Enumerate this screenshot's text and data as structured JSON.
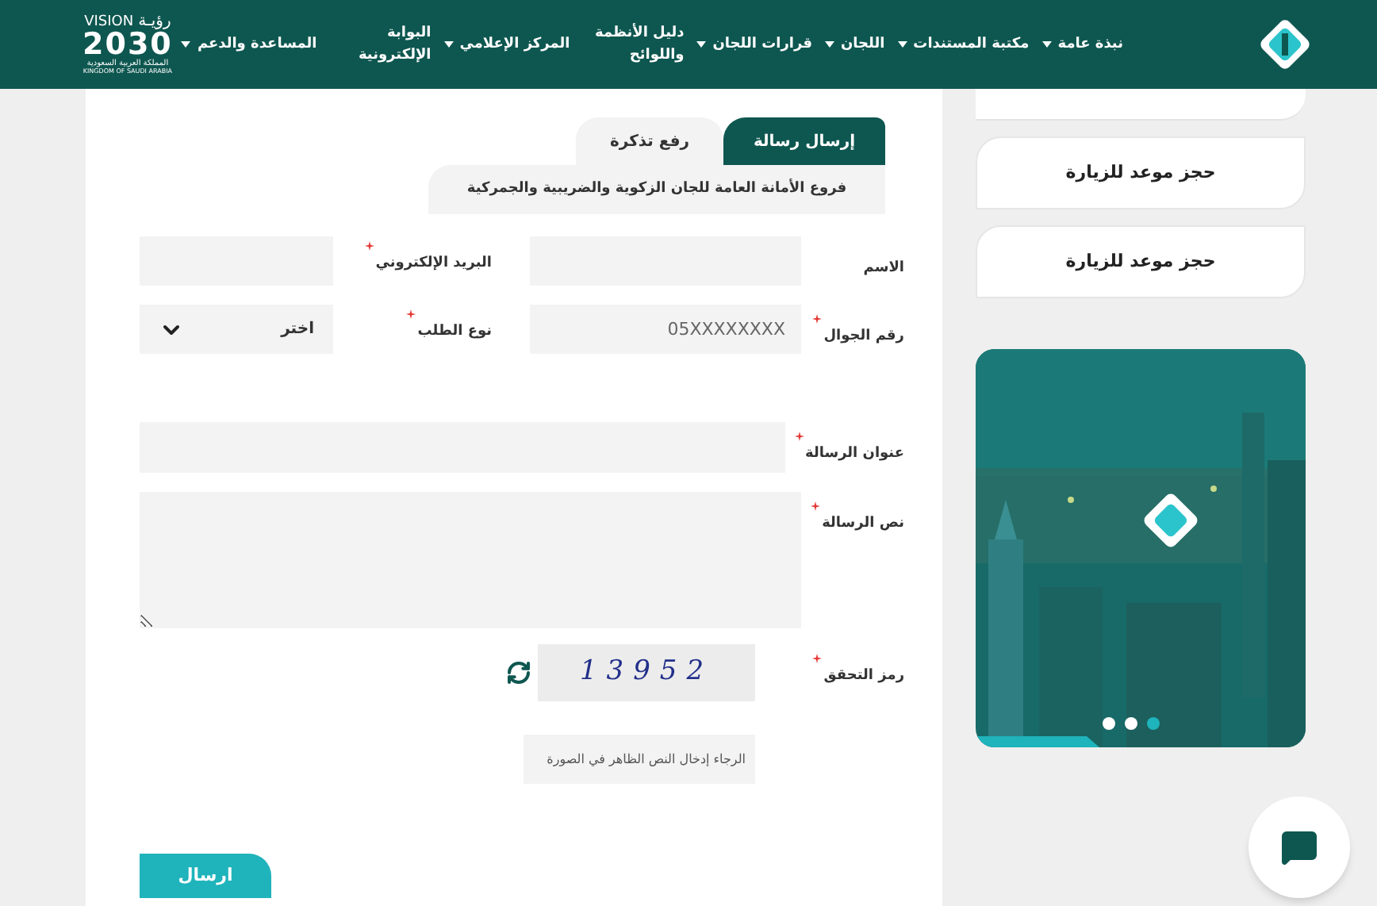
{
  "header": {
    "vision_logo": {
      "arabic": "رؤيـة",
      "latin": "VISION",
      "year": "2030",
      "country_ar": "المملكة العربية السعودية",
      "country_en": "KINGDOM OF SAUDI ARABIA"
    },
    "nav": [
      {
        "label": "نبذة عامة",
        "has_menu": true
      },
      {
        "label": "مكتبة المستندات",
        "has_menu": true
      },
      {
        "label": "اللجان",
        "has_menu": true
      },
      {
        "label": "قرارات اللجان",
        "has_menu": true
      },
      {
        "label": "دليل الأنظمة واللوائح",
        "has_menu": false
      },
      {
        "label": "المركز الإعلامي",
        "has_menu": true
      },
      {
        "label": "البوابة الإلكترونية",
        "has_menu": false
      },
      {
        "label": "المساعدة والدعم",
        "has_menu": true
      }
    ]
  },
  "tabs": [
    {
      "label": "إرسال رسالة",
      "selected": true
    },
    {
      "label": "رفع تذكرة",
      "selected": false
    }
  ],
  "branches_tab": "فروع الأمانة العامة للجان الزكوية والضريبية والجمركية",
  "form": {
    "rows": [
      [
        {
          "label": "الاسم",
          "required": false,
          "kind": "text"
        },
        {
          "label": "البريد الإلكتروني",
          "required": true,
          "kind": "text"
        }
      ],
      [
        {
          "label": "رقم الجوال",
          "required": true,
          "kind": "text",
          "placeholder": "05XXXXXXXX"
        },
        {
          "label": "نوع الطلب",
          "required": true,
          "kind": "select",
          "value": "اختر"
        }
      ]
    ],
    "title": {
      "label": "عنوان الرسالة",
      "required": true
    },
    "body": {
      "label": "نص الرسالة",
      "required": true
    },
    "captcha": {
      "label": "رمز التحقق",
      "required": true,
      "code": "13952",
      "placeholder": "الرجاء إدخال النص الظاهر في الصورة"
    },
    "submit": "ارسال"
  },
  "sidebar": {
    "links": [
      {
        "label": "حجز موعد للزيارة"
      },
      {
        "label": "حجز موعد للزيارة"
      }
    ],
    "carousel": {
      "dots": [
        {
          "selected": false
        },
        {
          "selected": false
        },
        {
          "selected": true
        }
      ]
    }
  }
}
